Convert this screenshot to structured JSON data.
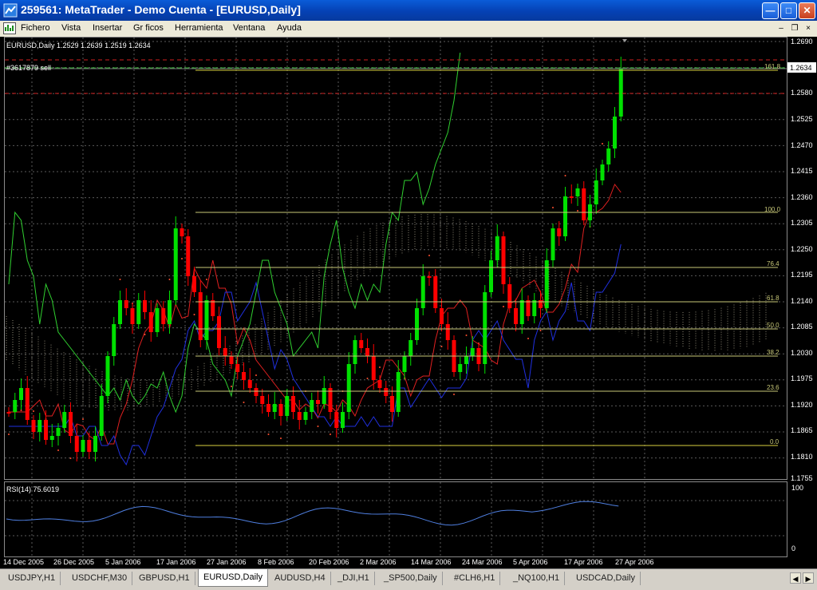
{
  "window": {
    "title": "259561: MetaTrader - Demo Cuenta - [EURUSD,Daily]"
  },
  "menu": {
    "items": [
      "Fichero",
      "Vista",
      "Insertar",
      "Gr ficos",
      "Herramienta",
      "Ventana",
      "Ayuda"
    ]
  },
  "chart": {
    "info_label": "EURUSD,Daily  1.2529 1.2639 1.2519 1.2634",
    "order_label": "#3617879 sell",
    "current_price": "1.2634",
    "price_axis": [
      "1.2690",
      "1.2634",
      "1.2580",
      "1.2525",
      "1.2470",
      "1.2415",
      "1.2360",
      "1.2305",
      "1.2250",
      "1.2195",
      "1.2140",
      "1.2085",
      "1.2030",
      "1.1975",
      "1.1920",
      "1.1865",
      "1.1810",
      "1.1755"
    ],
    "fib_levels": [
      "161.8",
      "100.0",
      "76.4",
      "61.8",
      "50.0",
      "38.2",
      "23.6",
      "0.0"
    ],
    "date_axis": [
      "14 Dec 2005",
      "26 Dec 2005",
      "5 Jan 2006",
      "17 Jan 2006",
      "27 Jan 2006",
      "8 Feb 2006",
      "20 Feb 2006",
      "2 Mar 2006",
      "14 Mar 2006",
      "24 Mar 2006",
      "5 Apr 2006",
      "17 Apr 2006",
      "27 Apr 2006"
    ],
    "colors": {
      "bull": "#00e000",
      "bear": "#ff0000",
      "grid": "#5a5a5a",
      "fib": "#c8c878",
      "rsi": "#4f7fe0"
    }
  },
  "rsi": {
    "label": "RSI(14) 75.6019",
    "axis": [
      "100",
      "0"
    ]
  },
  "tabs": [
    "USDJPY,H1",
    "USDCHF,M30",
    "GBPUSD,H1",
    "EURUSD,Daily",
    "AUDUSD,H4",
    "_DJI,H1",
    "_SP500,Daily",
    "#CLH6,H1",
    "_NQ100,H1",
    "USDCAD,Daily"
  ],
  "active_tab": "EURUSD,Daily"
}
